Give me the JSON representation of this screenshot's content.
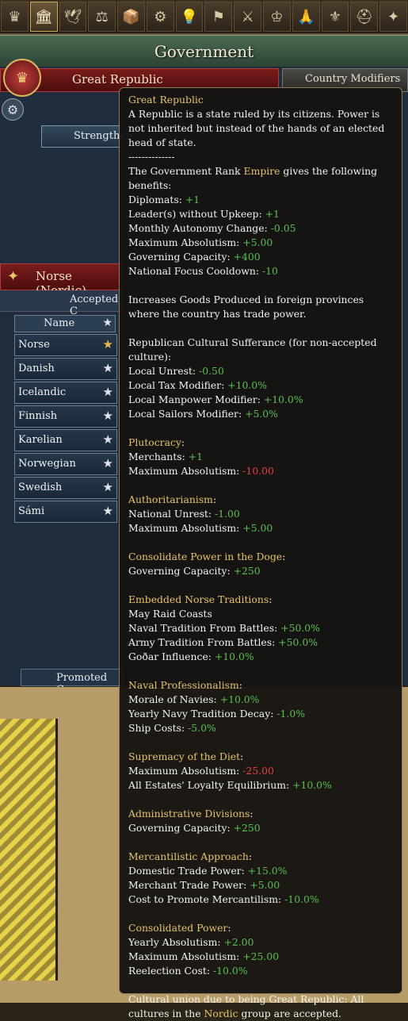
{
  "header": {
    "title": "Government"
  },
  "topbar": {
    "tabs": [
      {
        "icon": "crown-icon",
        "glyph": "♛"
      },
      {
        "icon": "government-building-icon",
        "glyph": "🏛"
      },
      {
        "icon": "dove-icon",
        "glyph": "🕊"
      },
      {
        "icon": "courthouse-icon",
        "glyph": "⚖"
      },
      {
        "icon": "trade-crate-icon",
        "glyph": "📦"
      },
      {
        "icon": "gears-icon",
        "glyph": "⚙"
      },
      {
        "icon": "idea-lightbulb-icon",
        "glyph": "💡"
      },
      {
        "icon": "flag-icon",
        "glyph": "⚑"
      },
      {
        "icon": "sword-icon",
        "glyph": "⚔"
      },
      {
        "icon": "estates-crown-icon",
        "glyph": "♔"
      },
      {
        "icon": "praying-hands-icon",
        "glyph": "🙏"
      },
      {
        "icon": "subjects-icon",
        "glyph": "⚜"
      },
      {
        "icon": "helmet-icon",
        "glyph": "⛑"
      },
      {
        "icon": "scroll-icon",
        "glyph": "✦"
      }
    ]
  },
  "government": {
    "type_label": "Great Republic",
    "country_modifiers_label": "Country Modifiers",
    "strengthen_label": "Strengthen"
  },
  "culture": {
    "primary_label": "Norse (Nordic)",
    "accepted_label": "Accepted C",
    "column_name": "Name",
    "rows": [
      "Norse",
      "Danish",
      "Icelandic",
      "Finnish",
      "Karelian",
      "Norwegian",
      "Swedish",
      "Sámi"
    ],
    "promoted_label": "Promoted Cu"
  },
  "tooltip": {
    "title": "Great Republic",
    "description": "A Republic is a state ruled by its citizens. Power is not inherited but instead of the hands of an elected head of state.",
    "divider": "--------------",
    "rank_intro_1": "The Government Rank ",
    "rank_name": "Empire",
    "rank_intro_2": " gives the following benefits:",
    "rank_benefits": [
      {
        "label": "Diplomats: ",
        "value": "+1",
        "color": "g"
      },
      {
        "label": "Leader(s) without Upkeep: ",
        "value": "+1",
        "color": "g"
      },
      {
        "label": "Monthly Autonomy Change: ",
        "value": "-0.05",
        "color": "g"
      },
      {
        "label": "Maximum Absolutism: ",
        "value": "+5.00",
        "color": "g"
      },
      {
        "label": "Governing Capacity: ",
        "value": "+400",
        "color": "g"
      },
      {
        "label": "National Focus Cooldown: ",
        "value": "-10",
        "color": "g"
      }
    ],
    "goods_text": "Increases Goods Produced in foreign provinces where the country has trade power.",
    "sufferance_title": "Republican Cultural Sufferance (for non-accepted culture):",
    "sufferance": [
      {
        "label": "Local Unrest: ",
        "value": "-0.50",
        "color": "g"
      },
      {
        "label": "Local Tax Modifier: ",
        "value": "+10.0%",
        "color": "g"
      },
      {
        "label": "Local Manpower Modifier: ",
        "value": "+10.0%",
        "color": "g"
      },
      {
        "label": "Local Sailors Modifier: ",
        "value": "+5.0%",
        "color": "g"
      }
    ],
    "reforms": [
      {
        "name": "Plutocracy",
        "effects": [
          {
            "label": "Merchants: ",
            "value": "+1",
            "color": "g"
          },
          {
            "label": "Maximum Absolutism: ",
            "value": "-10.00",
            "color": "r"
          }
        ]
      },
      {
        "name": "Authoritarianism",
        "effects": [
          {
            "label": "National Unrest: ",
            "value": "-1.00",
            "color": "g"
          },
          {
            "label": "Maximum Absolutism: ",
            "value": "+5.00",
            "color": "g"
          }
        ]
      },
      {
        "name": "Consolidate Power in the Doge",
        "effects": [
          {
            "label": "Governing Capacity: ",
            "value": "+250",
            "color": "g"
          }
        ]
      },
      {
        "name": "Embedded Norse Traditions",
        "effects": [
          {
            "label": "May Raid Coasts",
            "value": "",
            "color": "g"
          },
          {
            "label": "Naval Tradition From Battles: ",
            "value": "+50.0%",
            "color": "g"
          },
          {
            "label": "Army Tradition From Battles: ",
            "value": "+50.0%",
            "color": "g"
          },
          {
            "label": "Goðar Influence: ",
            "value": "+10.0%",
            "color": "g"
          }
        ]
      },
      {
        "name": "Naval Professionalism",
        "effects": [
          {
            "label": "Morale of Navies: ",
            "value": "+10.0%",
            "color": "g"
          },
          {
            "label": "Yearly Navy Tradition Decay: ",
            "value": "-1.0%",
            "color": "g"
          },
          {
            "label": "Ship Costs: ",
            "value": "-5.0%",
            "color": "g"
          }
        ]
      },
      {
        "name": "Supremacy of the Diet",
        "effects": [
          {
            "label": "Maximum Absolutism: ",
            "value": "-25.00",
            "color": "r"
          },
          {
            "label": "All Estates' Loyalty Equilibrium: ",
            "value": "+10.0%",
            "color": "g"
          }
        ]
      },
      {
        "name": "Administrative Divisions",
        "effects": [
          {
            "label": "Governing Capacity: ",
            "value": "+250",
            "color": "g"
          }
        ]
      },
      {
        "name": "Mercantilistic Approach",
        "effects": [
          {
            "label": "Domestic Trade Power: ",
            "value": "+15.0%",
            "color": "g"
          },
          {
            "label": "Merchant Trade Power: ",
            "value": "+5.00",
            "color": "g"
          },
          {
            "label": "Cost to Promote Mercantilism: ",
            "value": "-10.0%",
            "color": "g"
          }
        ]
      },
      {
        "name": "Consolidated Power",
        "effects": [
          {
            "label": "Yearly Absolutism: ",
            "value": "+2.00",
            "color": "g"
          },
          {
            "label": "Maximum Absolutism: ",
            "value": "+25.00",
            "color": "g"
          },
          {
            "label": "Reelection Cost: ",
            "value": "-10.0%",
            "color": "g"
          }
        ]
      }
    ],
    "union_1": "Cultural union due to being Great Republic: All cultures in the ",
    "union_group": "Nordic",
    "union_2": " group are accepted."
  }
}
